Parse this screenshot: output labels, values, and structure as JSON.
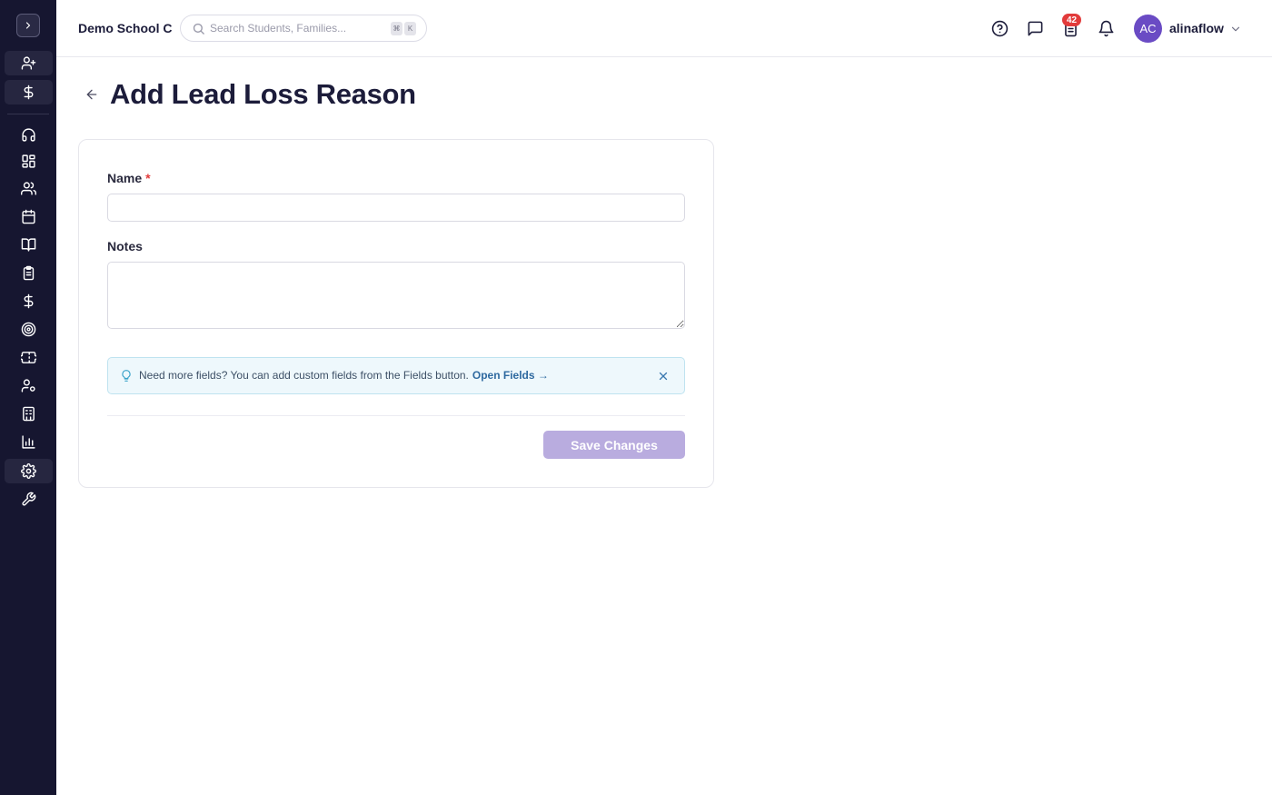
{
  "header": {
    "school_name": "Demo School C",
    "search": {
      "placeholder": "Search Students, Families...",
      "shortcut_keys": [
        "⌘",
        "K"
      ]
    },
    "icons": [
      "help-circle-icon",
      "message-square-icon",
      "clipboard-list-icon",
      "bell-icon"
    ],
    "tasks_badge": "42",
    "user": {
      "initials": "AC",
      "name": "alinaflow"
    }
  },
  "sidebar": {
    "toggle_icon": "chevron-right-icon",
    "items": [
      {
        "icon": "user-plus-icon",
        "shaded": true
      },
      {
        "icon": "dollar-sign-icon",
        "shaded": true
      },
      {
        "icon": "headset-icon"
      },
      {
        "icon": "layout-dashboard-icon"
      },
      {
        "icon": "users-icon"
      },
      {
        "icon": "calendar-icon"
      },
      {
        "icon": "book-open-icon"
      },
      {
        "icon": "clipboard-check-icon"
      },
      {
        "icon": "dollar-sign-icon"
      },
      {
        "icon": "target-icon"
      },
      {
        "icon": "ticket-icon"
      },
      {
        "icon": "user-cog-icon"
      },
      {
        "icon": "building-icon"
      },
      {
        "icon": "bar-chart-icon"
      },
      {
        "icon": "settings-icon",
        "active": true
      },
      {
        "icon": "wrench-icon"
      }
    ]
  },
  "page": {
    "title": "Add Lead Loss Reason",
    "back_icon": "arrow-left-icon"
  },
  "form": {
    "name_label": "Name",
    "required_mark": "*",
    "name_value": "",
    "notes_label": "Notes",
    "notes_value": "",
    "tip_text": "Need more fields? You can add custom fields from the Fields button.",
    "tip_link": "Open Fields →",
    "save_label": "Save Changes"
  },
  "colors": {
    "sidebar_bg": "#161630",
    "title": "#1c1c3a",
    "avatar": "#6a4bc4",
    "badge": "#e23b3b",
    "save_disabled": "#b9acdf",
    "tip_bg": "#eef8fc",
    "tip_link": "#2f6aa0"
  }
}
